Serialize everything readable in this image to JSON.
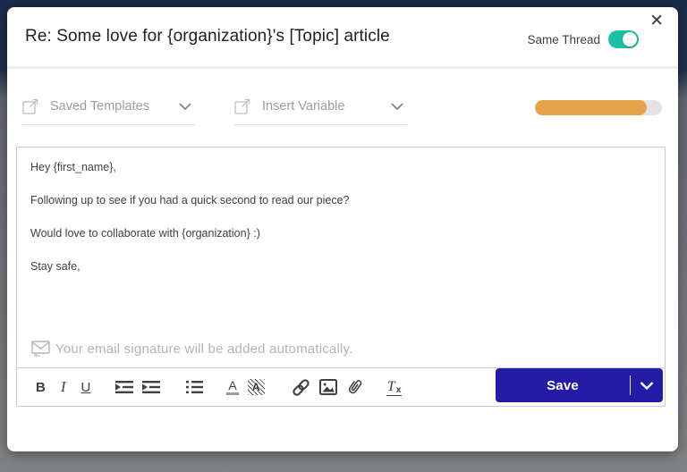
{
  "header": {
    "title": "Re: Some love for {organization}'s [Topic] article",
    "same_thread_label": "Same Thread",
    "same_thread_state": "on",
    "close_glyph": "✕"
  },
  "template_bar": {
    "saved_templates_label": "Saved Templates",
    "insert_variable_label": "Insert Variable",
    "progress_percent": 88,
    "progress_color": "#e5a44c"
  },
  "editor": {
    "paragraphs": [
      "Hey {first_name},",
      "Following up to see if you had a quick second to read our piece?",
      "Would love to collaborate with {organization} :)",
      "Stay safe,"
    ],
    "signature_note": "Your email signature will be added automatically."
  },
  "format_toolbar": {
    "bold_glyph": "B",
    "italic_glyph": "I",
    "underline_glyph": "U",
    "text_color_glyph": "A",
    "highlight_glyph": "A",
    "clear_format_glyph": "T",
    "clear_format_sub": "x"
  },
  "footer": {
    "save_label": "Save"
  },
  "colors": {
    "accent_teal": "#1fbfa7",
    "save_blue": "#241ca6",
    "progress_orange": "#e5a44c"
  }
}
